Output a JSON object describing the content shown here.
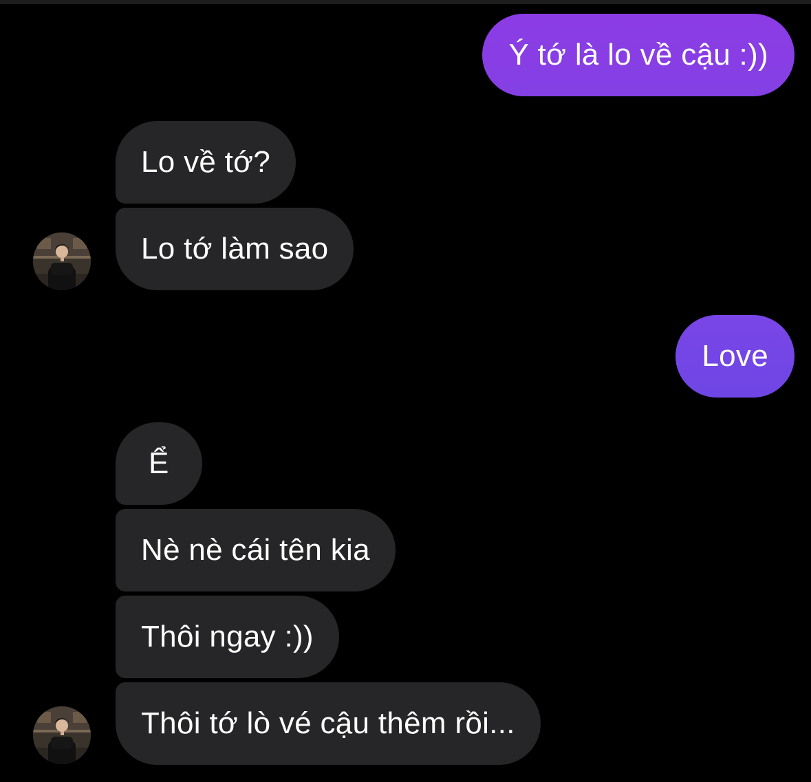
{
  "colors": {
    "background": "#000000",
    "incoming_bubble": "#262628",
    "outgoing_bubble_top": "#8a3de3",
    "outgoing_bubble_bottom": "#6f45e6",
    "text": "#ffffff"
  },
  "messages": [
    {
      "direction": "outgoing",
      "text": "Ý tớ là lo về cậu :))"
    },
    {
      "direction": "incoming",
      "text": "Lo về tớ?"
    },
    {
      "direction": "incoming",
      "text": "Lo tớ làm sao"
    },
    {
      "direction": "outgoing",
      "text": "Love"
    },
    {
      "direction": "incoming",
      "text": "Ể"
    },
    {
      "direction": "incoming",
      "text": "Nè nè cái tên kia"
    },
    {
      "direction": "incoming",
      "text": "Thôi ngay :))"
    },
    {
      "direction": "incoming",
      "text": "Thôi tớ lò vé cậu thêm rồi..."
    }
  ],
  "contact": {
    "avatar_icon": "profile-photo-person-in-black-jacket"
  }
}
